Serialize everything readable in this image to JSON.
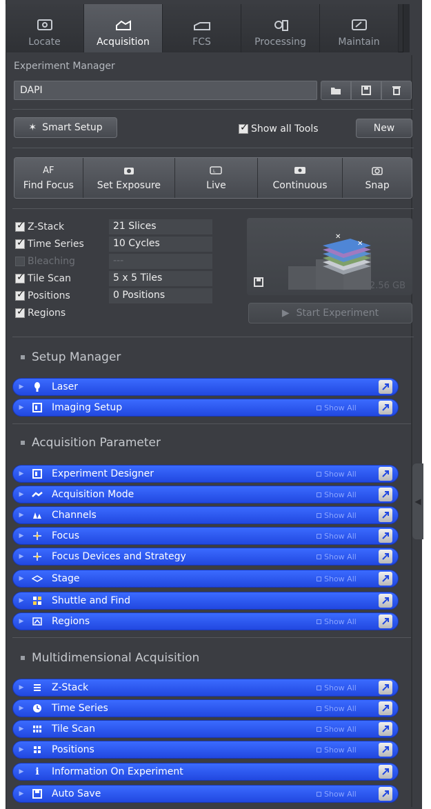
{
  "tabs": [
    {
      "label": "Locate",
      "icon": "locate-icon",
      "active": false
    },
    {
      "label": "Acquisition",
      "icon": "acquisition-icon",
      "active": true
    },
    {
      "label": "FCS",
      "icon": "fcs-icon",
      "active": false
    },
    {
      "label": "Processing",
      "icon": "processing-icon",
      "active": false
    },
    {
      "label": "Maintain",
      "icon": "maintain-icon",
      "active": false
    }
  ],
  "experiment_manager": {
    "label": "Experiment Manager",
    "value": "DAPI"
  },
  "smart_setup": {
    "label": "Smart Setup"
  },
  "show_all_tools": {
    "label": "Show all Tools",
    "checked": true
  },
  "new_button": {
    "label": "New"
  },
  "actions": [
    {
      "top": "AF",
      "label": "Find Focus"
    },
    {
      "top": "",
      "label": "Set Exposure"
    },
    {
      "top": "",
      "label": "Live"
    },
    {
      "top": "",
      "label": "Continuous"
    },
    {
      "top": "",
      "label": "Snap"
    }
  ],
  "options": [
    {
      "name": "Z-Stack",
      "value": "21 Slices",
      "checked": true,
      "enabled": true
    },
    {
      "name": "Time Series",
      "value": "10 Cycles",
      "checked": true,
      "enabled": true
    },
    {
      "name": "Bleaching",
      "value": "---",
      "checked": false,
      "enabled": false
    },
    {
      "name": "Tile Scan",
      "value": "5 x 5 Tiles",
      "checked": true,
      "enabled": true
    },
    {
      "name": "Positions",
      "value": "0 Positions",
      "checked": true,
      "enabled": true
    },
    {
      "name": "Regions",
      "value": "",
      "checked": true,
      "enabled": true
    }
  ],
  "preview": {
    "size": "2.56 GB"
  },
  "start_experiment": {
    "label": "Start Experiment"
  },
  "sections": {
    "setup_manager": {
      "title": "Setup Manager",
      "tools": [
        {
          "label": "Laser",
          "icon": "laser-icon",
          "show_all": ""
        },
        {
          "label": "Imaging Setup",
          "icon": "imaging-setup-icon",
          "show_all": "Show All"
        }
      ]
    },
    "acquisition_parameter": {
      "title": "Acquisition Parameter",
      "tools": [
        {
          "label": "Experiment Designer",
          "icon": "experiment-designer-icon",
          "show_all": "Show All"
        },
        {
          "label": "Acquisition Mode",
          "icon": "acquisition-mode-icon",
          "show_all": "Show All"
        },
        {
          "label": "Channels",
          "icon": "channels-icon",
          "show_all": "Show All"
        },
        {
          "label": "Focus",
          "icon": "focus-icon",
          "show_all": "Show All"
        },
        {
          "label": "Focus Devices and Strategy",
          "icon": "focus-devices-icon",
          "show_all": "Show All"
        },
        {
          "label": "Stage",
          "icon": "stage-icon",
          "show_all": "Show All"
        },
        {
          "label": "Shuttle and Find",
          "icon": "shuttle-find-icon",
          "show_all": ""
        },
        {
          "label": "Regions",
          "icon": "regions-icon",
          "show_all": "Show All"
        }
      ]
    },
    "multidimensional": {
      "title": "Multidimensional Acquisition",
      "tools": [
        {
          "label": "Z-Stack",
          "icon": "z-stack-icon",
          "show_all": "Show All"
        },
        {
          "label": "Time Series",
          "icon": "time-series-icon",
          "show_all": "Show All"
        },
        {
          "label": "Tile Scan",
          "icon": "tile-scan-icon",
          "show_all": "Show All"
        },
        {
          "label": "Positions",
          "icon": "positions-icon",
          "show_all": "Show All"
        },
        {
          "label": "Information On Experiment",
          "icon": "information-icon",
          "show_all": ""
        },
        {
          "label": "Auto Save",
          "icon": "auto-save-icon",
          "show_all": "Show All"
        }
      ]
    }
  },
  "colors": {
    "tool_bar": "#2f5cff",
    "panel": "#3b3d42"
  }
}
